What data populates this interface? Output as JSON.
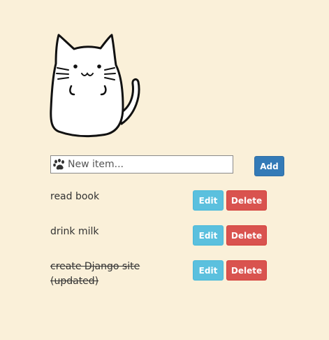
{
  "new_item": {
    "placeholder": "New item..."
  },
  "add_label": "Add",
  "items": [
    {
      "text": "read book",
      "done": false,
      "edit_label": "Edit",
      "delete_label": "Delete"
    },
    {
      "text": "drink milk",
      "done": false,
      "edit_label": "Edit",
      "delete_label": "Delete"
    },
    {
      "text": "create Django site (updated)",
      "done": true,
      "edit_label": "Edit",
      "delete_label": "Delete"
    }
  ],
  "icons": {
    "mascot": "cat-icon",
    "input_prefix": "paw-icon"
  }
}
